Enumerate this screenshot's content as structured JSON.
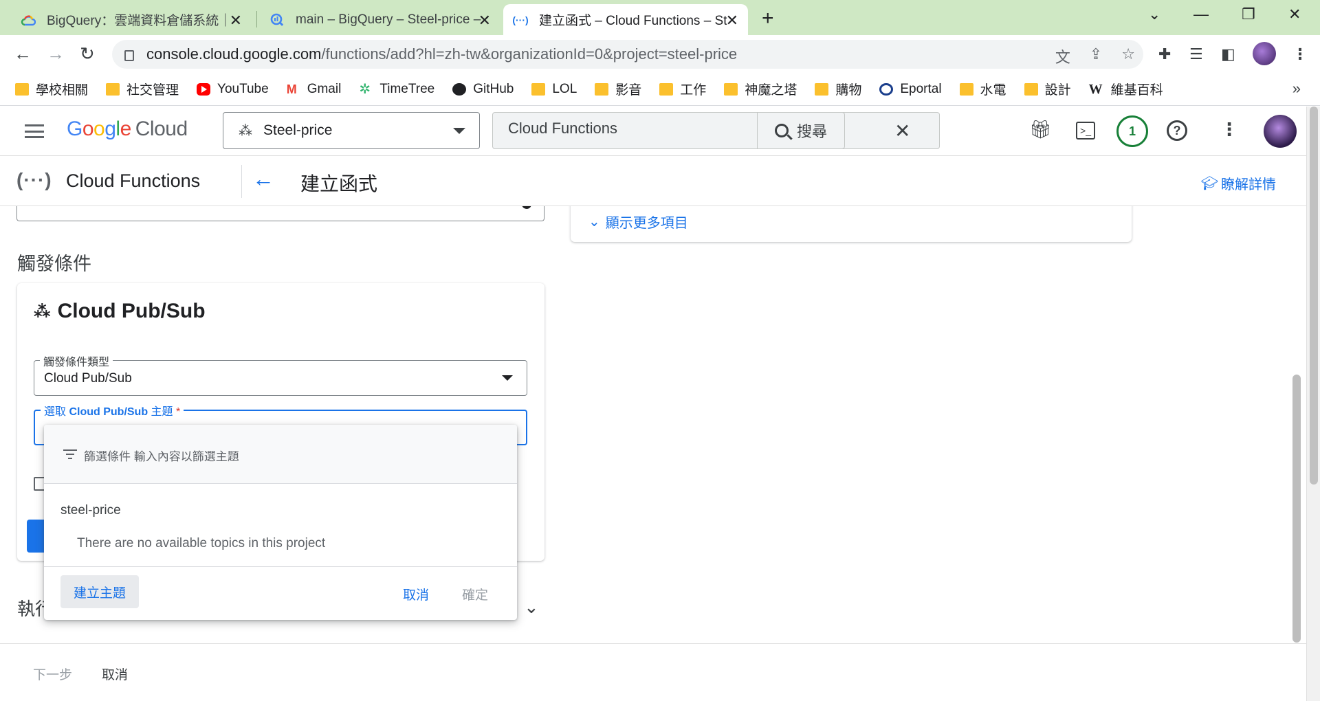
{
  "browser": {
    "tabs": [
      {
        "title": "BigQuery：雲端資料倉儲系統｜",
        "active": false
      },
      {
        "title": "main – BigQuery – Steel-price –",
        "active": false
      },
      {
        "title": "建立函式 – Cloud Functions – St",
        "active": true
      }
    ],
    "url_host": "console.cloud.google.com",
    "url_path": "/functions/add?hl=zh-tw&organizationId=0&project=steel-price",
    "bookmarks": [
      {
        "label": "學校相關",
        "icon": "folder-icon"
      },
      {
        "label": "社交管理",
        "icon": "folder-icon"
      },
      {
        "label": "YouTube",
        "icon": "youtube-icon"
      },
      {
        "label": "Gmail",
        "icon": "gmail-icon"
      },
      {
        "label": "TimeTree",
        "icon": "timetree-icon"
      },
      {
        "label": "GitHub",
        "icon": "github-icon"
      },
      {
        "label": "LOL",
        "icon": "folder-icon"
      },
      {
        "label": "影音",
        "icon": "folder-icon"
      },
      {
        "label": "工作",
        "icon": "folder-icon"
      },
      {
        "label": "神魔之塔",
        "icon": "folder-icon"
      },
      {
        "label": "購物",
        "icon": "folder-icon"
      },
      {
        "label": "Eportal",
        "icon": "eportal-icon"
      },
      {
        "label": "水電",
        "icon": "folder-icon"
      },
      {
        "label": "設計",
        "icon": "folder-icon"
      },
      {
        "label": "維基百科",
        "icon": "wikipedia-icon"
      }
    ],
    "bookmarks_more": "»"
  },
  "gcp_header": {
    "logo_google": [
      "G",
      "o",
      "o",
      "g",
      "l",
      "e"
    ],
    "logo_cloud": "Cloud",
    "project_name": "Steel-price",
    "search_value": "Cloud Functions",
    "search_button": "搜尋",
    "notification_count": "1"
  },
  "subheader": {
    "product_icon": "(···)",
    "product_name": "Cloud Functions",
    "page_title": "建立函式",
    "learn_more": "瞭解詳情"
  },
  "content": {
    "show_more": "顯示更多項目",
    "trigger_section_title": "觸發條件",
    "card_title": "Cloud Pub/Sub",
    "trigger_type_label": "觸發條件類型",
    "trigger_type_value": "Cloud Pub/Sub",
    "topic_label_prefix": "選取 ",
    "topic_label_bold": "Cloud Pub/Sub",
    "topic_label_suffix": " 主題 ",
    "topic_label_required": "*",
    "runtime_section_partial": "執行"
  },
  "dropdown": {
    "filter_text": "篩選條件  輸入內容以篩選主題",
    "group_label": "steel-price",
    "empty_message": "There are no available topics in this project",
    "create_topic": "建立主題",
    "cancel": "取消",
    "ok": "確定"
  },
  "bottom_bar": {
    "next": "下一步",
    "cancel": "取消"
  },
  "colors": {
    "accent": "#1a73e8",
    "tabstrip": "#cfe8c4",
    "success": "#188038",
    "required": "#d93025"
  }
}
